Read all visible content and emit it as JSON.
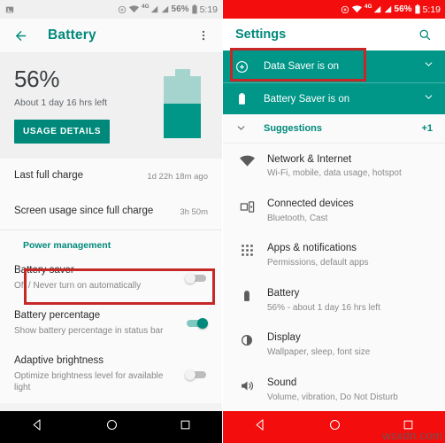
{
  "left_screen": {
    "status_bar": {
      "data_saver_icon": "data-saver-icon",
      "wifi_icon": "wifi-icon",
      "network_type": "4G",
      "signal_icon_1": "signal-bars-icon",
      "signal_icon_2": "signal-bars-icon",
      "battery_percent": "56%",
      "battery_icon": "battery-icon",
      "time": "5:19"
    },
    "app_bar": {
      "back_icon": "back-arrow-icon",
      "title": "Battery",
      "overflow_icon": "more-vertical-icon"
    },
    "hero": {
      "percent": "56%",
      "estimate": "About 1 day 16 hrs left",
      "button_label": "USAGE DETAILS",
      "battery_graphic_fill_percent": 56,
      "battery_fill_color": "#009688",
      "battery_body_color": "#a5d4cf"
    },
    "info_rows": [
      {
        "title": "Last full charge",
        "value": "1d 22h 18m ago"
      },
      {
        "title": "Screen usage since full charge",
        "value": "3h 50m"
      }
    ],
    "section_header": "Power management",
    "settings_rows": [
      {
        "title": "Battery saver",
        "sub": "Off / Never turn on automatically",
        "toggle": "off",
        "highlighted": true
      },
      {
        "title": "Battery percentage",
        "sub": "Show battery percentage in status bar",
        "toggle": "on",
        "highlighted": false
      },
      {
        "title": "Adaptive brightness",
        "sub": "Optimize brightness level for available light",
        "toggle": "off",
        "highlighted": false
      }
    ],
    "nav_bar": {
      "back_icon": "nav-back-triangle-icon",
      "home_icon": "nav-home-circle-icon",
      "recents_icon": "nav-recents-square-icon",
      "color": "#000000"
    }
  },
  "right_screen": {
    "status_bar": {
      "data_saver_icon": "data-saver-icon",
      "wifi_icon": "wifi-icon",
      "network_type": "4G",
      "signal_icon_1": "signal-bars-icon",
      "signal_icon_2": "signal-bars-icon",
      "battery_percent": "56%",
      "battery_icon": "battery-icon",
      "time": "5:19",
      "color": "#f40d0d"
    },
    "app_bar": {
      "title": "Settings",
      "search_icon": "search-icon"
    },
    "banners": [
      {
        "label": "Data Saver is on",
        "icon": "data-saver-icon",
        "chevron": "chevron-down-icon",
        "highlighted": true
      },
      {
        "label": "Battery Saver is on",
        "icon": "battery-icon",
        "chevron": "chevron-down-icon",
        "highlighted": false
      }
    ],
    "suggestions": {
      "chevron": "chevron-down-icon",
      "label": "Suggestions",
      "count": "+1"
    },
    "items": [
      {
        "icon": "wifi-icon",
        "title": "Network & Internet",
        "sub": "Wi-Fi, mobile, data usage, hotspot"
      },
      {
        "icon": "connected-devices-icon",
        "title": "Connected devices",
        "sub": "Bluetooth, Cast"
      },
      {
        "icon": "apps-grid-icon",
        "title": "Apps & notifications",
        "sub": "Permissions, default apps"
      },
      {
        "icon": "battery-icon",
        "title": "Battery",
        "sub": "56% - about 1 day 16 hrs left"
      },
      {
        "icon": "brightness-icon",
        "title": "Display",
        "sub": "Wallpaper, sleep, font size"
      },
      {
        "icon": "volume-icon",
        "title": "Sound",
        "sub": "Volume, vibration, Do Not Disturb"
      }
    ],
    "nav_bar": {
      "back_icon": "nav-back-triangle-icon",
      "home_icon": "nav-home-circle-icon",
      "recents_icon": "nav-recents-square-icon",
      "color": "#f40d0d"
    },
    "watermark": "wsxdn.com"
  },
  "colors": {
    "teal": "#009688",
    "teal_dark": "#00897b",
    "red_bar": "#f40d0d",
    "highlight_box": "#c62828"
  }
}
